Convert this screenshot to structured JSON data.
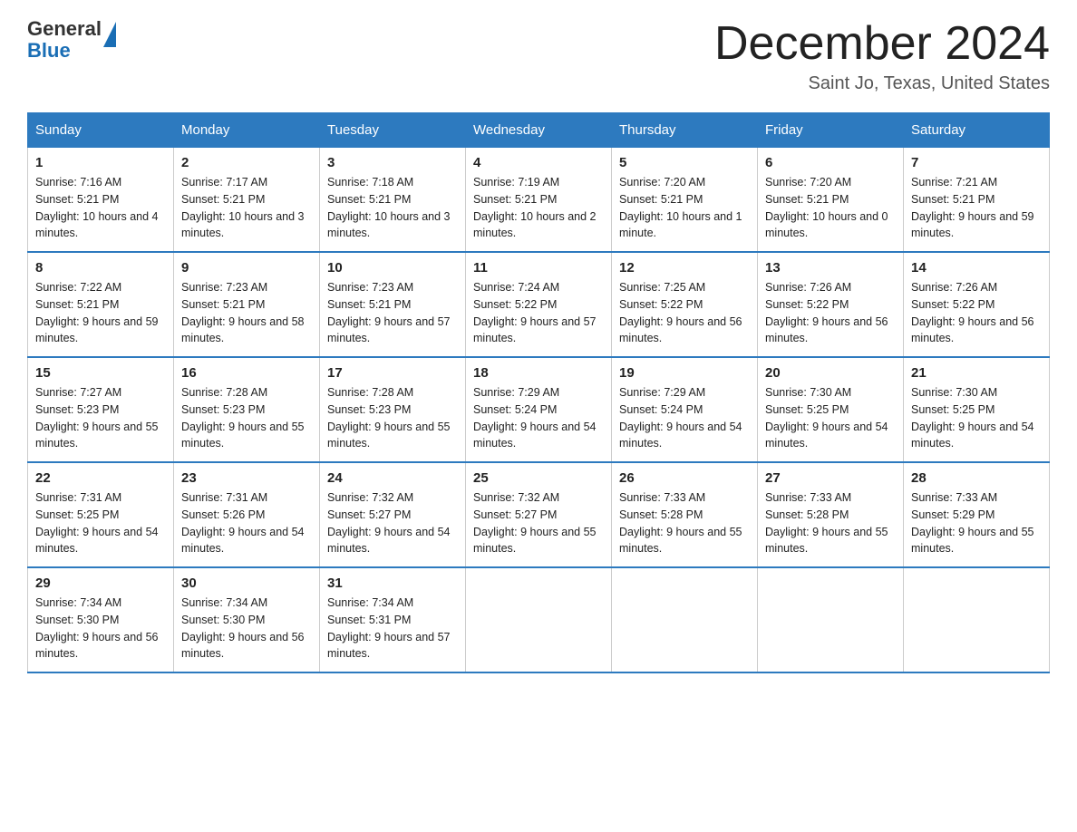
{
  "header": {
    "logo_general": "General",
    "logo_blue": "Blue",
    "month_title": "December 2024",
    "location": "Saint Jo, Texas, United States"
  },
  "days_of_week": [
    "Sunday",
    "Monday",
    "Tuesday",
    "Wednesday",
    "Thursday",
    "Friday",
    "Saturday"
  ],
  "weeks": [
    [
      {
        "day": "1",
        "sunrise": "7:16 AM",
        "sunset": "5:21 PM",
        "daylight": "10 hours and 4 minutes."
      },
      {
        "day": "2",
        "sunrise": "7:17 AM",
        "sunset": "5:21 PM",
        "daylight": "10 hours and 3 minutes."
      },
      {
        "day": "3",
        "sunrise": "7:18 AM",
        "sunset": "5:21 PM",
        "daylight": "10 hours and 3 minutes."
      },
      {
        "day": "4",
        "sunrise": "7:19 AM",
        "sunset": "5:21 PM",
        "daylight": "10 hours and 2 minutes."
      },
      {
        "day": "5",
        "sunrise": "7:20 AM",
        "sunset": "5:21 PM",
        "daylight": "10 hours and 1 minute."
      },
      {
        "day": "6",
        "sunrise": "7:20 AM",
        "sunset": "5:21 PM",
        "daylight": "10 hours and 0 minutes."
      },
      {
        "day": "7",
        "sunrise": "7:21 AM",
        "sunset": "5:21 PM",
        "daylight": "9 hours and 59 minutes."
      }
    ],
    [
      {
        "day": "8",
        "sunrise": "7:22 AM",
        "sunset": "5:21 PM",
        "daylight": "9 hours and 59 minutes."
      },
      {
        "day": "9",
        "sunrise": "7:23 AM",
        "sunset": "5:21 PM",
        "daylight": "9 hours and 58 minutes."
      },
      {
        "day": "10",
        "sunrise": "7:23 AM",
        "sunset": "5:21 PM",
        "daylight": "9 hours and 57 minutes."
      },
      {
        "day": "11",
        "sunrise": "7:24 AM",
        "sunset": "5:22 PM",
        "daylight": "9 hours and 57 minutes."
      },
      {
        "day": "12",
        "sunrise": "7:25 AM",
        "sunset": "5:22 PM",
        "daylight": "9 hours and 56 minutes."
      },
      {
        "day": "13",
        "sunrise": "7:26 AM",
        "sunset": "5:22 PM",
        "daylight": "9 hours and 56 minutes."
      },
      {
        "day": "14",
        "sunrise": "7:26 AM",
        "sunset": "5:22 PM",
        "daylight": "9 hours and 56 minutes."
      }
    ],
    [
      {
        "day": "15",
        "sunrise": "7:27 AM",
        "sunset": "5:23 PM",
        "daylight": "9 hours and 55 minutes."
      },
      {
        "day": "16",
        "sunrise": "7:28 AM",
        "sunset": "5:23 PM",
        "daylight": "9 hours and 55 minutes."
      },
      {
        "day": "17",
        "sunrise": "7:28 AM",
        "sunset": "5:23 PM",
        "daylight": "9 hours and 55 minutes."
      },
      {
        "day": "18",
        "sunrise": "7:29 AM",
        "sunset": "5:24 PM",
        "daylight": "9 hours and 54 minutes."
      },
      {
        "day": "19",
        "sunrise": "7:29 AM",
        "sunset": "5:24 PM",
        "daylight": "9 hours and 54 minutes."
      },
      {
        "day": "20",
        "sunrise": "7:30 AM",
        "sunset": "5:25 PM",
        "daylight": "9 hours and 54 minutes."
      },
      {
        "day": "21",
        "sunrise": "7:30 AM",
        "sunset": "5:25 PM",
        "daylight": "9 hours and 54 minutes."
      }
    ],
    [
      {
        "day": "22",
        "sunrise": "7:31 AM",
        "sunset": "5:25 PM",
        "daylight": "9 hours and 54 minutes."
      },
      {
        "day": "23",
        "sunrise": "7:31 AM",
        "sunset": "5:26 PM",
        "daylight": "9 hours and 54 minutes."
      },
      {
        "day": "24",
        "sunrise": "7:32 AM",
        "sunset": "5:27 PM",
        "daylight": "9 hours and 54 minutes."
      },
      {
        "day": "25",
        "sunrise": "7:32 AM",
        "sunset": "5:27 PM",
        "daylight": "9 hours and 55 minutes."
      },
      {
        "day": "26",
        "sunrise": "7:33 AM",
        "sunset": "5:28 PM",
        "daylight": "9 hours and 55 minutes."
      },
      {
        "day": "27",
        "sunrise": "7:33 AM",
        "sunset": "5:28 PM",
        "daylight": "9 hours and 55 minutes."
      },
      {
        "day": "28",
        "sunrise": "7:33 AM",
        "sunset": "5:29 PM",
        "daylight": "9 hours and 55 minutes."
      }
    ],
    [
      {
        "day": "29",
        "sunrise": "7:34 AM",
        "sunset": "5:30 PM",
        "daylight": "9 hours and 56 minutes."
      },
      {
        "day": "30",
        "sunrise": "7:34 AM",
        "sunset": "5:30 PM",
        "daylight": "9 hours and 56 minutes."
      },
      {
        "day": "31",
        "sunrise": "7:34 AM",
        "sunset": "5:31 PM",
        "daylight": "9 hours and 57 minutes."
      },
      null,
      null,
      null,
      null
    ]
  ],
  "labels": {
    "sunrise": "Sunrise:",
    "sunset": "Sunset:",
    "daylight": "Daylight:"
  }
}
